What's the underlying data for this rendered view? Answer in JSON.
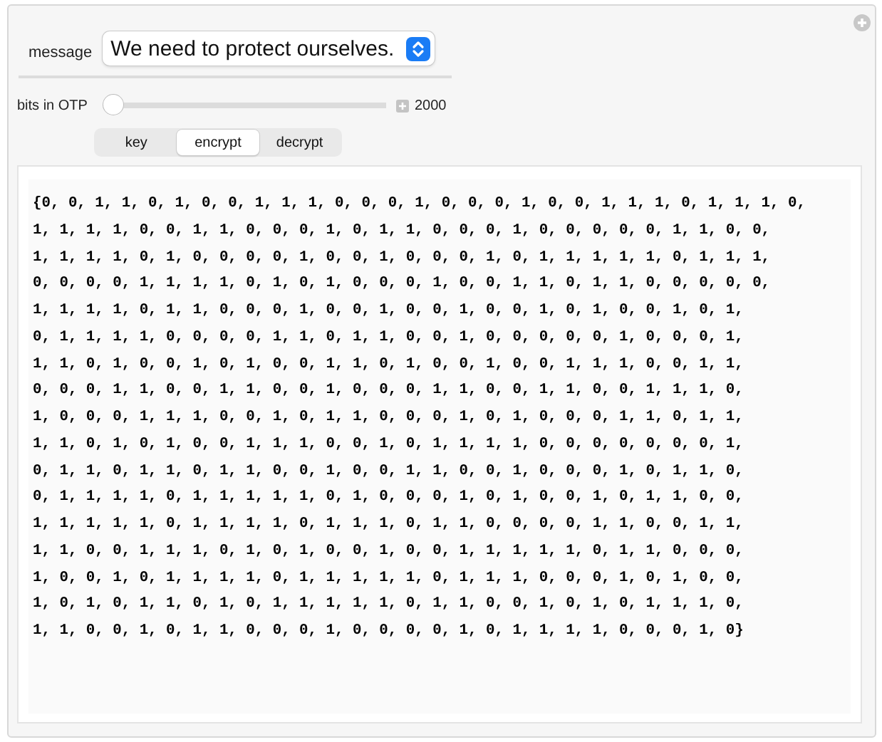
{
  "message": {
    "label": "message",
    "value": "We need to protect ourselves."
  },
  "slider": {
    "label": "bits in OTP",
    "level": 0.0,
    "reading": "2000"
  },
  "tabs": [
    {
      "label": "key",
      "selected": false
    },
    {
      "label": "encrypt",
      "selected": true
    },
    {
      "label": "decrypt",
      "selected": false
    }
  ],
  "output": {
    "lines": [
      "{0, 0, 1, 1, 0, 1, 0, 0, 1, 1, 1, 0, 0, 0, 1, 0, 0, 0, 1, 0, 0, 1, 1, 1, 0, 1, 1, 1, 0,",
      "1, 1, 1, 1, 0, 0, 1, 1, 0, 0, 0, 1, 0, 1, 1, 0, 0, 0, 1, 0, 0, 0, 0, 0, 1, 1, 0, 0,",
      "1, 1, 1, 1, 0, 1, 0, 0, 0, 0, 1, 0, 0, 1, 0, 0, 0, 1, 0, 1, 1, 1, 1, 1, 0, 1, 1, 1,",
      "0, 0, 0, 0, 1, 1, 1, 1, 0, 1, 0, 1, 0, 0, 0, 1, 0, 0, 1, 1, 0, 1, 1, 0, 0, 0, 0, 0,",
      "1, 1, 1, 1, 0, 1, 1, 0, 0, 0, 1, 0, 0, 1, 0, 0, 1, 0, 0, 1, 0, 1, 0, 0, 1, 0, 1,",
      "0, 1, 1, 1, 1, 0, 0, 0, 0, 1, 1, 0, 1, 1, 0, 0, 1, 0, 0, 0, 0, 0, 1, 0, 0, 0, 1,",
      "1, 1, 0, 1, 0, 0, 1, 0, 1, 0, 0, 1, 1, 0, 1, 0, 0, 1, 0, 0, 1, 1, 1, 0, 0, 1, 1,",
      "0, 0, 0, 1, 1, 0, 0, 1, 1, 0, 0, 1, 0, 0, 0, 1, 1, 0, 0, 1, 1, 0, 0, 1, 1, 1, 0,",
      "1, 0, 0, 0, 1, 1, 1, 0, 0, 1, 0, 1, 1, 0, 0, 0, 1, 0, 1, 0, 0, 0, 1, 1, 0, 1, 1,",
      "1, 1, 0, 1, 0, 1, 0, 0, 1, 1, 1, 0, 0, 1, 0, 1, 1, 1, 1, 0, 0, 0, 0, 0, 0, 0, 1,",
      "0, 1, 1, 0, 1, 1, 0, 1, 1, 0, 0, 1, 0, 0, 1, 1, 0, 0, 1, 0, 0, 0, 1, 0, 1, 1, 0,",
      "0, 1, 1, 1, 1, 0, 1, 1, 1, 1, 1, 0, 1, 0, 0, 0, 1, 0, 1, 0, 0, 1, 0, 1, 1, 0, 0,",
      "1, 1, 1, 1, 1, 0, 1, 1, 1, 1, 0, 1, 1, 1, 0, 1, 1, 0, 0, 0, 0, 1, 1, 0, 0, 1, 1,",
      "1, 1, 0, 0, 1, 1, 1, 0, 1, 0, 1, 0, 0, 1, 0, 0, 1, 1, 1, 1, 1, 0, 1, 1, 0, 0, 0,",
      "1, 0, 0, 1, 0, 1, 1, 1, 1, 0, 1, 1, 1, 1, 1, 0, 1, 1, 1, 0, 0, 0, 1, 0, 1, 0, 0,",
      "1, 0, 1, 0, 1, 1, 0, 1, 0, 1, 1, 1, 1, 1, 0, 1, 1, 0, 0, 1, 0, 1, 0, 1, 1, 1, 0,",
      "1, 1, 0, 0, 1, 0, 1, 1, 0, 0, 0, 1, 0, 0, 0, 0, 1, 0, 1, 1, 1, 1, 0, 0, 0, 1, 0}"
    ]
  }
}
